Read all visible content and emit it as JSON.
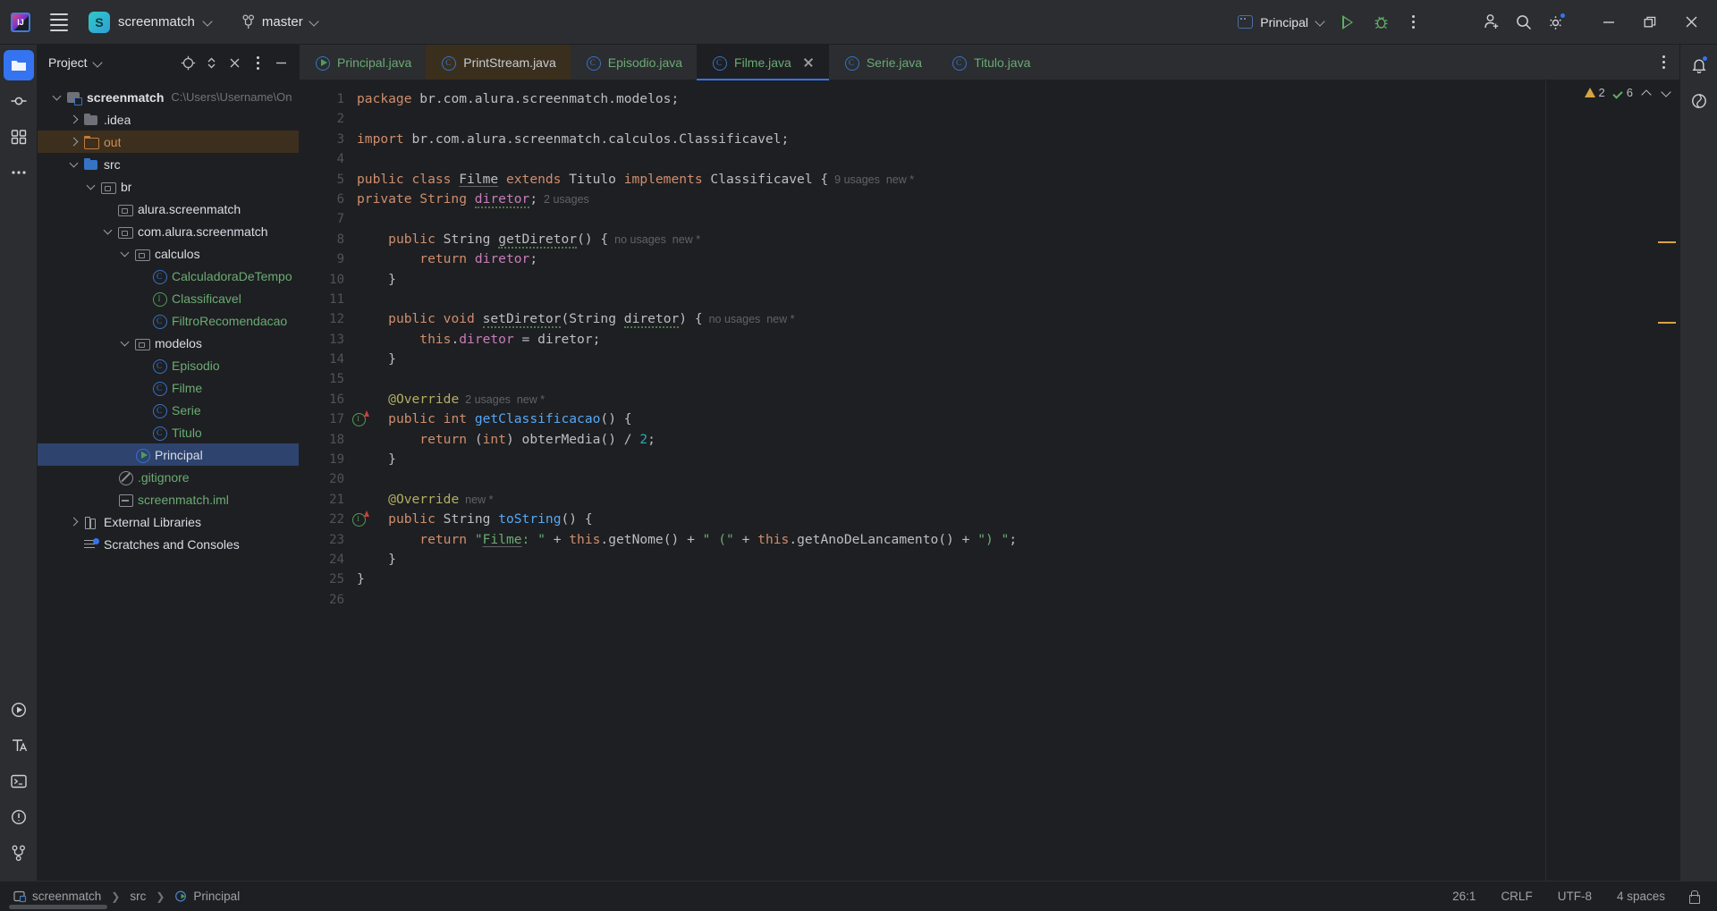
{
  "titlebar": {
    "menu_icon": "hamburger-icon",
    "project_avatar_letter": "S",
    "project_name": "screenmatch",
    "branch_name": "master",
    "run_config_name": "Principal",
    "run_label": "run-icon",
    "debug_label": "debug-icon",
    "more_label": "more-actions-icon"
  },
  "project_panel": {
    "title": "Project",
    "actions": [
      "select-opened-file-icon",
      "expand-collapse-icon",
      "collapse-all-icon",
      "options-icon",
      "hide-icon"
    ],
    "tree": [
      {
        "label": "screenmatch",
        "path": "C:\\Users\\Username\\On",
        "icon": "module-icon",
        "depth": 0,
        "twist": "down",
        "style": "bold"
      },
      {
        "label": ".idea",
        "path": "",
        "icon": "folder-icon",
        "depth": 1,
        "twist": "right",
        "style": "plain"
      },
      {
        "label": "out",
        "path": "",
        "icon": "folder-excluded-icon",
        "depth": 1,
        "twist": "right",
        "style": "orange",
        "row": "excluded"
      },
      {
        "label": "src",
        "path": "",
        "icon": "folder-source-icon",
        "depth": 1,
        "twist": "down",
        "style": "plain"
      },
      {
        "label": "br",
        "path": "",
        "icon": "package-icon",
        "depth": 2,
        "twist": "down",
        "style": "plain"
      },
      {
        "label": "alura.screenmatch",
        "path": "",
        "icon": "package-icon",
        "depth": 3,
        "twist": "none",
        "style": "plain"
      },
      {
        "label": "com.alura.screenmatch",
        "path": "",
        "icon": "package-icon",
        "depth": 3,
        "twist": "down",
        "style": "plain"
      },
      {
        "label": "calculos",
        "path": "",
        "icon": "package-icon",
        "depth": 4,
        "twist": "down",
        "style": "plain"
      },
      {
        "label": "CalculadoraDeTempo",
        "path": "",
        "icon": "class-icon",
        "depth": 5,
        "twist": "none",
        "style": "green"
      },
      {
        "label": "Classificavel",
        "path": "",
        "icon": "interface-icon",
        "depth": 5,
        "twist": "none",
        "style": "green"
      },
      {
        "label": "FiltroRecomendacao",
        "path": "",
        "icon": "class-icon",
        "depth": 5,
        "twist": "none",
        "style": "green"
      },
      {
        "label": "modelos",
        "path": "",
        "icon": "package-icon",
        "depth": 4,
        "twist": "down",
        "style": "plain"
      },
      {
        "label": "Episodio",
        "path": "",
        "icon": "class-icon",
        "depth": 5,
        "twist": "none",
        "style": "green"
      },
      {
        "label": "Filme",
        "path": "",
        "icon": "class-icon",
        "depth": 5,
        "twist": "none",
        "style": "green"
      },
      {
        "label": "Serie",
        "path": "",
        "icon": "class-icon",
        "depth": 5,
        "twist": "none",
        "style": "green"
      },
      {
        "label": "Titulo",
        "path": "",
        "icon": "class-icon",
        "depth": 5,
        "twist": "none",
        "style": "green"
      },
      {
        "label": "Principal",
        "path": "",
        "icon": "runnable-class-icon",
        "depth": 4,
        "twist": "none",
        "style": "plain",
        "row": "selected"
      },
      {
        "label": ".gitignore",
        "path": "",
        "icon": "gitignore-icon",
        "depth": 3,
        "twist": "none",
        "style": "green"
      },
      {
        "label": "screenmatch.iml",
        "path": "",
        "icon": "iml-file-icon",
        "depth": 3,
        "twist": "none",
        "style": "green"
      },
      {
        "label": "External Libraries",
        "path": "",
        "icon": "library-icon",
        "depth": 1,
        "twist": "right",
        "style": "plain"
      },
      {
        "label": "Scratches and Consoles",
        "path": "",
        "icon": "scratches-icon",
        "depth": 1,
        "twist": "none",
        "style": "plain"
      }
    ]
  },
  "tabs": [
    {
      "label": "Principal.java",
      "icon": "runnable-class-icon",
      "state": "normal"
    },
    {
      "label": "PrintStream.java",
      "icon": "class-icon",
      "state": "library"
    },
    {
      "label": "Episodio.java",
      "icon": "class-icon",
      "state": "normal"
    },
    {
      "label": "Filme.java",
      "icon": "class-icon",
      "state": "active"
    },
    {
      "label": "Serie.java",
      "icon": "class-icon",
      "state": "normal"
    },
    {
      "label": "Titulo.java",
      "icon": "class-icon",
      "state": "normal"
    }
  ],
  "editor": {
    "line_numbers": [
      1,
      2,
      3,
      4,
      5,
      6,
      7,
      8,
      9,
      10,
      11,
      12,
      13,
      14,
      15,
      16,
      17,
      18,
      19,
      20,
      21,
      22,
      23,
      24,
      25,
      26
    ],
    "inspection": {
      "warning_count": "2",
      "ok_count": "6"
    },
    "lines": [
      {
        "n": 1,
        "tokens": [
          {
            "t": "package ",
            "c": "kw"
          },
          {
            "t": "br.com.alura.screenmatch.modelos;",
            "c": "txt"
          }
        ]
      },
      {
        "n": 2,
        "tokens": []
      },
      {
        "n": 3,
        "tokens": [
          {
            "t": "import ",
            "c": "kw"
          },
          {
            "t": "br.com.alura.screenmatch.calculos.Classificavel;",
            "c": "txt"
          }
        ]
      },
      {
        "n": 4,
        "tokens": []
      },
      {
        "n": 5,
        "tokens": [
          {
            "t": "public class ",
            "c": "kw"
          },
          {
            "t": "Filme",
            "c": "txt uline"
          },
          {
            "t": " extends ",
            "c": "kw"
          },
          {
            "t": "Titulo",
            "c": "txt"
          },
          {
            "t": " implements ",
            "c": "kw"
          },
          {
            "t": "Classificavel {",
            "c": "txt"
          },
          {
            "t": "  9 usages  new *",
            "c": "hint"
          }
        ]
      },
      {
        "n": 6,
        "tokens": [
          {
            "t": "private String ",
            "c": "kw"
          },
          {
            "t": "diretor",
            "c": "fld wavy"
          },
          {
            "t": ";",
            "c": "txt"
          },
          {
            "t": "  2 usages",
            "c": "hint"
          }
        ]
      },
      {
        "n": 7,
        "tokens": []
      },
      {
        "n": 8,
        "tokens": [
          {
            "t": "    ",
            "c": "txt"
          },
          {
            "t": "public ",
            "c": "kw"
          },
          {
            "t": "String ",
            "c": "txt"
          },
          {
            "t": "getDiretor",
            "c": "mth wavy"
          },
          {
            "t": "() {",
            "c": "txt"
          },
          {
            "t": "  no usages  new *",
            "c": "hint"
          }
        ]
      },
      {
        "n": 9,
        "tokens": [
          {
            "t": "        ",
            "c": "txt"
          },
          {
            "t": "return ",
            "c": "kw"
          },
          {
            "t": "diretor",
            "c": "fld"
          },
          {
            "t": ";",
            "c": "txt"
          }
        ]
      },
      {
        "n": 10,
        "tokens": [
          {
            "t": "    }",
            "c": "txt"
          }
        ]
      },
      {
        "n": 11,
        "tokens": []
      },
      {
        "n": 12,
        "tokens": [
          {
            "t": "    ",
            "c": "txt"
          },
          {
            "t": "public void ",
            "c": "kw"
          },
          {
            "t": "setDiretor",
            "c": "mth wavy"
          },
          {
            "t": "(",
            "c": "txt"
          },
          {
            "t": "String ",
            "c": "txt"
          },
          {
            "t": "diretor",
            "c": "txt wavy"
          },
          {
            "t": ") {",
            "c": "txt"
          },
          {
            "t": "  no usages  new *",
            "c": "hint"
          }
        ]
      },
      {
        "n": 13,
        "tokens": [
          {
            "t": "        ",
            "c": "txt"
          },
          {
            "t": "this",
            "c": "kw"
          },
          {
            "t": ".",
            "c": "txt"
          },
          {
            "t": "diretor",
            "c": "fld"
          },
          {
            "t": " = diretor;",
            "c": "txt"
          }
        ]
      },
      {
        "n": 14,
        "tokens": [
          {
            "t": "    }",
            "c": "txt"
          }
        ]
      },
      {
        "n": 15,
        "tokens": []
      },
      {
        "n": 16,
        "tokens": [
          {
            "t": "    ",
            "c": "txt"
          },
          {
            "t": "@Override",
            "c": "ann"
          },
          {
            "t": "  2 usages  new *",
            "c": "hint"
          }
        ]
      },
      {
        "n": 17,
        "tokens": [
          {
            "t": "    ",
            "c": "txt"
          },
          {
            "t": "public int ",
            "c": "kw"
          },
          {
            "t": "getClassificacao",
            "c": "mthb"
          },
          {
            "t": "() {",
            "c": "txt"
          }
        ],
        "gutter_mark": "override-icon"
      },
      {
        "n": 18,
        "tokens": [
          {
            "t": "        ",
            "c": "txt"
          },
          {
            "t": "return ",
            "c": "kw"
          },
          {
            "t": "(",
            "c": "txt"
          },
          {
            "t": "int",
            "c": "kw"
          },
          {
            "t": ") obterMedia() / ",
            "c": "txt"
          },
          {
            "t": "2",
            "c": "num"
          },
          {
            "t": ";",
            "c": "txt"
          }
        ]
      },
      {
        "n": 19,
        "tokens": [
          {
            "t": "    }",
            "c": "txt"
          }
        ]
      },
      {
        "n": 20,
        "tokens": []
      },
      {
        "n": 21,
        "tokens": [
          {
            "t": "    ",
            "c": "txt"
          },
          {
            "t": "@Override",
            "c": "ann"
          },
          {
            "t": "  new *",
            "c": "hint"
          }
        ]
      },
      {
        "n": 22,
        "tokens": [
          {
            "t": "    ",
            "c": "txt"
          },
          {
            "t": "public ",
            "c": "kw"
          },
          {
            "t": "String ",
            "c": "txt"
          },
          {
            "t": "toString",
            "c": "mthb"
          },
          {
            "t": "() {",
            "c": "txt"
          }
        ],
        "gutter_mark": "override-icon"
      },
      {
        "n": 23,
        "tokens": [
          {
            "t": "        ",
            "c": "txt"
          },
          {
            "t": "return ",
            "c": "kw"
          },
          {
            "t": "\"",
            "c": "str"
          },
          {
            "t": "Filme",
            "c": "str uline"
          },
          {
            "t": ": \"",
            "c": "str"
          },
          {
            "t": " + ",
            "c": "txt"
          },
          {
            "t": "this",
            "c": "kw"
          },
          {
            "t": ".getNome() + ",
            "c": "txt"
          },
          {
            "t": "\" (\"",
            "c": "str"
          },
          {
            "t": " + ",
            "c": "txt"
          },
          {
            "t": "this",
            "c": "kw"
          },
          {
            "t": ".getAnoDeLancamento() + ",
            "c": "txt"
          },
          {
            "t": "\") \"",
            "c": "str"
          },
          {
            "t": ";",
            "c": "txt"
          }
        ]
      },
      {
        "n": 24,
        "tokens": [
          {
            "t": "    }",
            "c": "txt"
          }
        ]
      },
      {
        "n": 25,
        "tokens": [
          {
            "t": "}",
            "c": "txt"
          }
        ]
      },
      {
        "n": 26,
        "tokens": []
      }
    ]
  },
  "statusbar": {
    "breadcrumb": [
      {
        "label": "screenmatch",
        "icon": "module-icon"
      },
      {
        "label": "src",
        "icon": "none"
      },
      {
        "label": "Principal",
        "icon": "runnable-class-icon"
      }
    ],
    "caret_position": "26:1",
    "line_separator": "CRLF",
    "encoding": "UTF-8",
    "indent": "4 spaces",
    "lock_icon": "lock-icon"
  },
  "colors": {
    "accent": "#3574f0",
    "background": "#1e1f22",
    "panel": "#2b2d30",
    "selection": "#2e436e",
    "excluded_row": "#3d2f1e",
    "keyword": "#cf8e6d",
    "string": "#6aab73",
    "field": "#c77dbb",
    "number": "#2aacb8",
    "annotation": "#b3ae60",
    "override_method": "#56a8f5",
    "warning": "#d9a343",
    "ok": "#5fad65"
  }
}
